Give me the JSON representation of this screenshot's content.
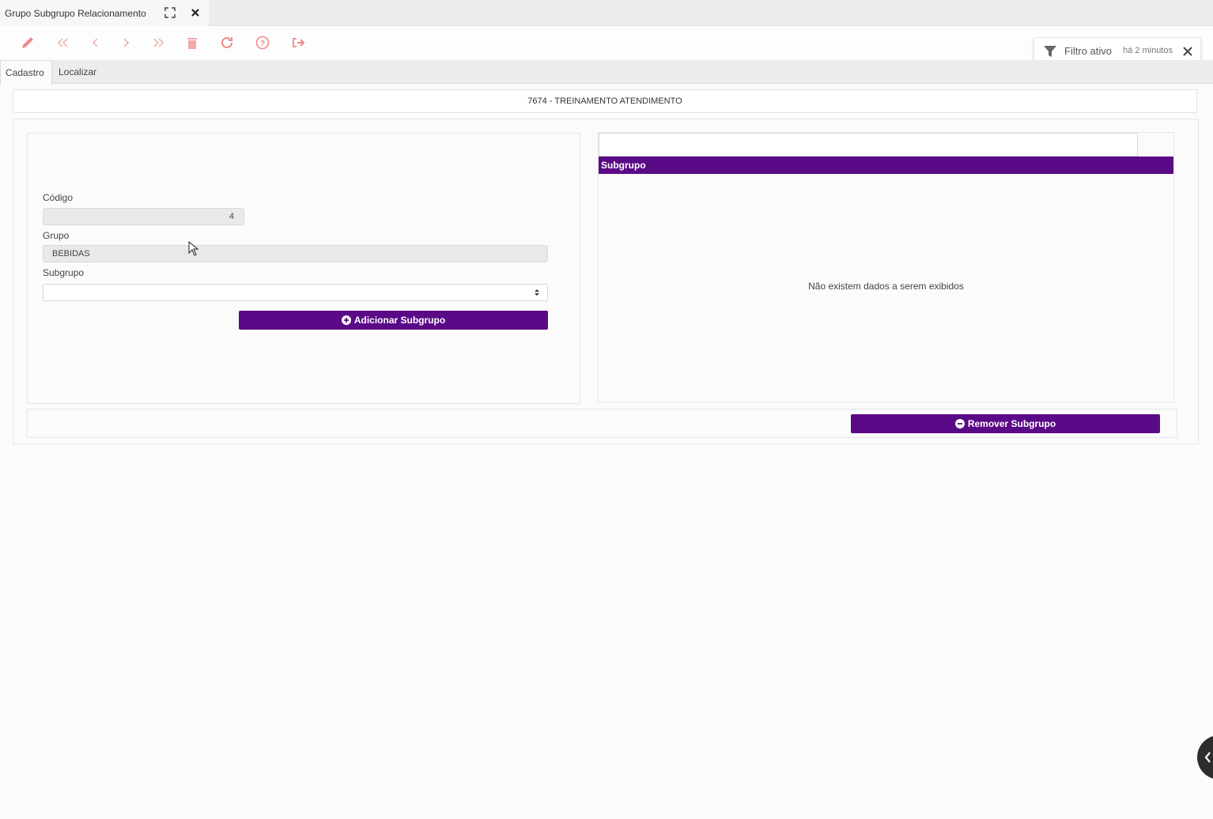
{
  "window": {
    "tab_title": "Grupo Subgrupo Relacionamento"
  },
  "toolbar": {
    "icons": [
      "pencil-icon",
      "first-icon",
      "previous-icon",
      "next-icon",
      "last-icon",
      "trash-icon",
      "refresh-icon",
      "help-icon",
      "exit-icon"
    ],
    "icon_color": "#ef8a8a"
  },
  "filter": {
    "label": "Filtro ativo",
    "time": "há 2 minutos"
  },
  "tabs": [
    {
      "label": "Cadastro",
      "active": true
    },
    {
      "label": "Localizar",
      "active": false
    }
  ],
  "company": "7674 - TREINAMENTO ATENDIMENTO",
  "form": {
    "codigo_label": "Código",
    "codigo_value": "4",
    "grupo_label": "Grupo",
    "grupo_value": "BEBIDAS",
    "subgrupo_label": "Subgrupo",
    "subgrupo_value": "",
    "add_button": "Adicionar Subgrupo"
  },
  "grid": {
    "filter_value": "",
    "column": "Subgrupo",
    "empty_message": "Não existem dados a serem exibidos"
  },
  "footer": {
    "remove_button": "Remover Subgrupo"
  },
  "colors": {
    "accent": "#5b0a87"
  }
}
